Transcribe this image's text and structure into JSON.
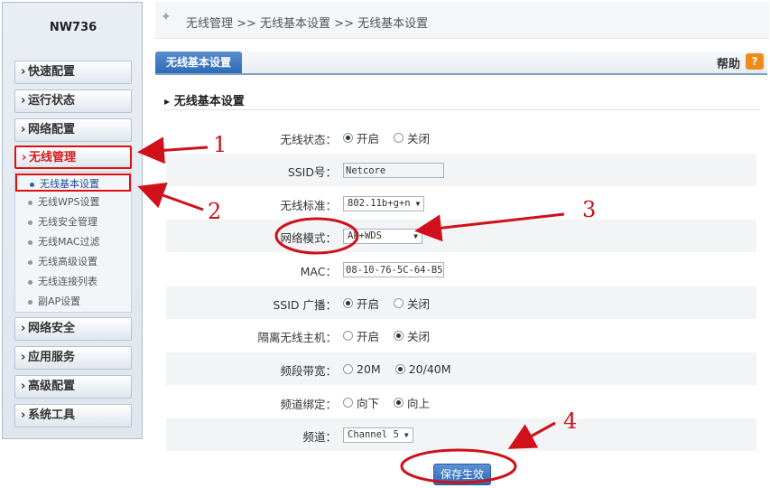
{
  "device": "NW736",
  "breadcrumb": {
    "text": "无线管理  >>  无线基本设置  >>  无线基本设置"
  },
  "tab": {
    "label": "无线基本设置"
  },
  "help": {
    "label": "帮助",
    "icon": "?"
  },
  "section_title": "无线基本设置",
  "sidebar": {
    "menus": [
      {
        "label": "快速配置"
      },
      {
        "label": "运行状态"
      },
      {
        "label": "网络配置"
      },
      {
        "label": "无线管理"
      }
    ],
    "submenu": [
      {
        "label": "无线基本设置"
      },
      {
        "label": "无线WPS设置"
      },
      {
        "label": "无线安全管理"
      },
      {
        "label": "无线MAC过滤"
      },
      {
        "label": "无线高级设置"
      },
      {
        "label": "无线连接列表"
      },
      {
        "label": "副AP设置"
      }
    ],
    "menus_bottom": [
      {
        "label": "网络安全"
      },
      {
        "label": "应用服务"
      },
      {
        "label": "高级配置"
      },
      {
        "label": "系统工具"
      }
    ]
  },
  "form": {
    "wireless_status": {
      "label": "无线状态：",
      "on": "开启",
      "off": "关闭"
    },
    "ssid": {
      "label": "SSID号：",
      "value": "Netcore"
    },
    "standard": {
      "label": "无线标准：",
      "value": "802.11b+g+n"
    },
    "mode": {
      "label": "网络模式：",
      "value": "AP+WDS"
    },
    "mac": {
      "label": "MAC：",
      "value": "08-10-76-5C-64-B5"
    },
    "ssid_broadcast": {
      "label": "SSID 广播：",
      "on": "开启",
      "off": "关闭"
    },
    "isolation": {
      "label": "隔离无线主机：",
      "on": "开启",
      "off": "关闭"
    },
    "bandwidth": {
      "label": "频段带宽：",
      "opt1": "20M",
      "opt2": "20/40M"
    },
    "channel_bind": {
      "label": "频道绑定：",
      "opt1": "向下",
      "opt2": "向上"
    },
    "channel": {
      "label": "频道：",
      "value": "Channel 5"
    }
  },
  "save_button": {
    "label": "保存生效"
  },
  "annotations": [
    "1",
    "2",
    "3",
    "4"
  ]
}
